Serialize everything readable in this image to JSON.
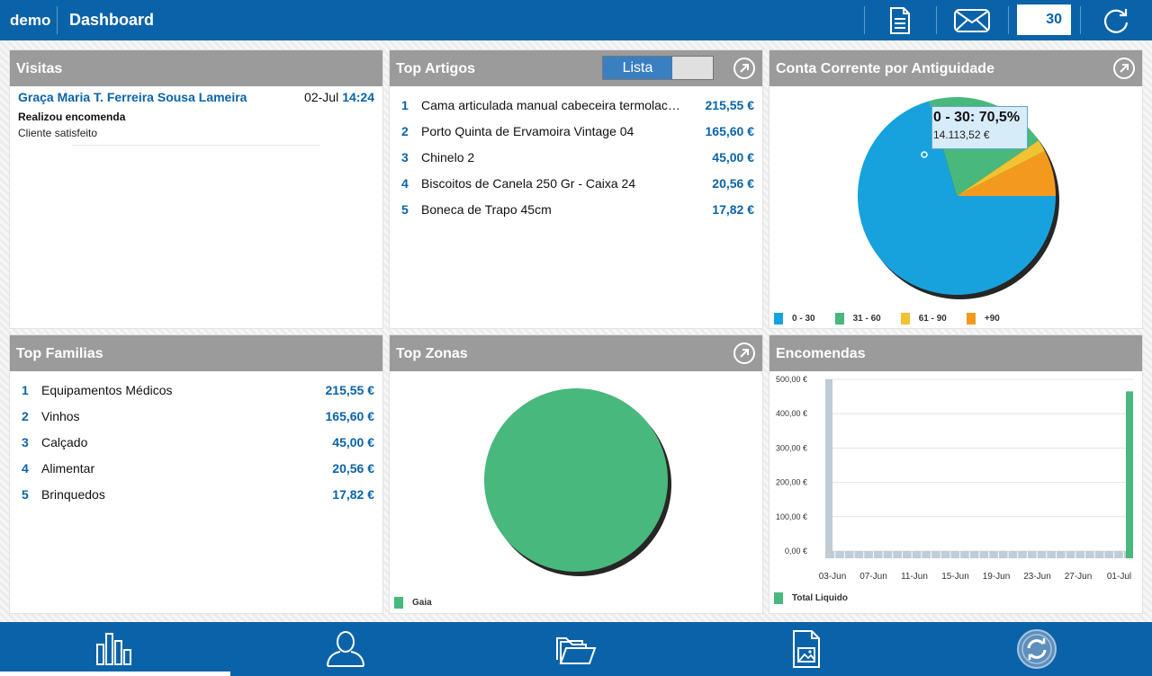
{
  "app": {
    "name": "demo",
    "title": "Dashboard",
    "period_days": "30"
  },
  "colors": {
    "primary": "#0a63a8",
    "panel_header": "#9b9b9b",
    "blue": "#17a2dd",
    "green": "#48b87c",
    "yellow": "#f1c232",
    "orange": "#f39a1e",
    "bar": "#c0ccd6"
  },
  "toolbar": {
    "icons": [
      "document-icon",
      "mail-icon",
      "refresh-icon"
    ]
  },
  "visitas": {
    "title": "Visitas",
    "items": [
      {
        "name": "Graça Maria T. Ferreira Sousa Lameira",
        "date": "02-Jul",
        "time": "14:24",
        "action": "Realizou encomenda",
        "note": "Cliente satisfeito"
      }
    ]
  },
  "top_artigos": {
    "title": "Top Artigos",
    "toggle_label": "Lista",
    "items": [
      {
        "rank": "1",
        "name": "Cama articulada manual cabeceira termolacada",
        "value": "215,55 €"
      },
      {
        "rank": "2",
        "name": "Porto Quinta de Ervamoira Vintage 04",
        "value": "165,60 €"
      },
      {
        "rank": "3",
        "name": "Chinelo 2",
        "value": "45,00 €"
      },
      {
        "rank": "4",
        "name": "Biscoitos de Canela 250 Gr - Caixa 24",
        "value": "20,56 €"
      },
      {
        "rank": "5",
        "name": "Boneca de Trapo 45cm",
        "value": "17,82 €"
      }
    ]
  },
  "conta_corrente": {
    "title": "Conta Corrente por Antiguidade",
    "tooltip": {
      "label": "0 - 30: 70,5%",
      "value": "14.113,52 €"
    },
    "legend": [
      "0 - 30",
      "31 - 60",
      "61 - 90",
      "+90"
    ]
  },
  "top_familias": {
    "title": "Top Familias",
    "items": [
      {
        "rank": "1",
        "name": "Equipamentos Médicos",
        "value": "215,55 €"
      },
      {
        "rank": "2",
        "name": "Vinhos",
        "value": "165,60 €"
      },
      {
        "rank": "3",
        "name": "Calçado",
        "value": "45,00 €"
      },
      {
        "rank": "4",
        "name": "Alimentar",
        "value": "20,56 €"
      },
      {
        "rank": "5",
        "name": "Brinquedos",
        "value": "17,82 €"
      }
    ]
  },
  "top_zonas": {
    "title": "Top Zonas",
    "legend": [
      "Gaia"
    ]
  },
  "encomendas": {
    "title": "Encomendas",
    "legend": [
      "Total Liquido"
    ]
  },
  "bottom_nav": {
    "icons": [
      "chart-bars-icon",
      "user-icon",
      "folders-icon",
      "image-document-icon",
      "sync-icon"
    ],
    "active_index": 0
  },
  "chart_data": [
    {
      "type": "pie",
      "categories": [
        "0 - 30",
        "31 - 60",
        "61 - 90",
        "+90"
      ],
      "values": [
        70.5,
        20.0,
        2.0,
        7.5
      ],
      "colors": [
        "#17a2dd",
        "#48b87c",
        "#f1c232",
        "#f39a1e"
      ]
    },
    {
      "type": "pie",
      "categories": [
        "Gaia"
      ],
      "values": [
        100
      ],
      "colors": [
        "#48b87c"
      ]
    },
    {
      "type": "bar",
      "series": [
        {
          "name": "Total Liquido"
        }
      ],
      "x_ticks": [
        "03-Jun",
        "07-Jun",
        "11-Jun",
        "15-Jun",
        "19-Jun",
        "23-Jun",
        "27-Jun",
        "01-Jul"
      ],
      "y_ticks": [
        "500,00 €",
        "400,00 €",
        "300,00 €",
        "200,00 €",
        "100,00 €",
        "0,00 €"
      ],
      "ylim": [
        0,
        500
      ],
      "bars": [
        {
          "x": "01-Jun",
          "value": 500
        },
        {
          "x": "02-Jul",
          "value": 465
        }
      ],
      "grid": true
    }
  ]
}
